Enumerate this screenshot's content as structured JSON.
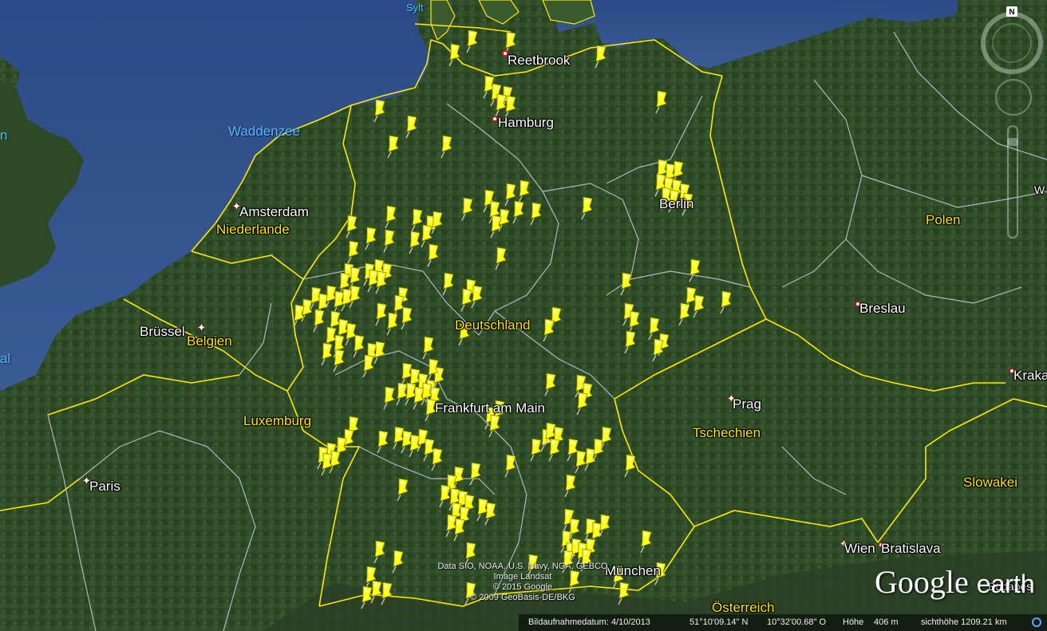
{
  "map": {
    "colors": {
      "sea": "#2f4e86",
      "land": "#2d4a27",
      "border_country": "#ffe800",
      "border_state": "#c8c8d8",
      "pin": "#ffff1e"
    },
    "cities": [
      {
        "name": "Sylt",
        "type": "water-small"
      },
      {
        "name": "Reetbrook",
        "type": "pin"
      },
      {
        "name": "Hamburg",
        "type": "dot"
      },
      {
        "name": "Amsterdam",
        "type": "star"
      },
      {
        "name": "Brüssel",
        "type": "star"
      },
      {
        "name": "Paris",
        "type": "star"
      },
      {
        "name": "Berlin",
        "type": "dot"
      },
      {
        "name": "Breslau",
        "type": "dot"
      },
      {
        "name": "Prag",
        "type": "star"
      },
      {
        "name": "Frankfurt am Main",
        "type": "none"
      },
      {
        "name": "Wien",
        "type": "star"
      },
      {
        "name": "Bratislava",
        "type": "dot"
      },
      {
        "name": "Kraka",
        "type": "dot"
      },
      {
        "name": "München",
        "type": "none"
      },
      {
        "name": "Budapes",
        "type": "none"
      }
    ],
    "countries": [
      "Niederlande",
      "Belgien",
      "Luxemburg",
      "Deutschland",
      "Polen",
      "Tschechien",
      "Slowakei",
      "Österreich"
    ],
    "water_labels": [
      "Waddenzee"
    ],
    "edge_labels": {
      "left_top": "n",
      "left_bottom": "al",
      "right_w": "W"
    },
    "pin_count": 187
  },
  "attribution": [
    "Data SIO, NOAA, U.S. Navy, NGA, GEBCO",
    "Image Landsat",
    "© 2015 Google",
    "© 2009 GeoBasis-DE/BKG"
  ],
  "logo": {
    "google": "Google",
    "earth": "earth"
  },
  "statusbar": {
    "date": "Bildaufnahmedatum: 4/10/2013",
    "lat": "51°10'09.14\" N",
    "lon": "10°32'00.68\" O",
    "elev_label": "Höhe",
    "elev": "406 m",
    "eye": "sichthöhe 1209.21 km"
  },
  "nav": {
    "north": "N"
  }
}
